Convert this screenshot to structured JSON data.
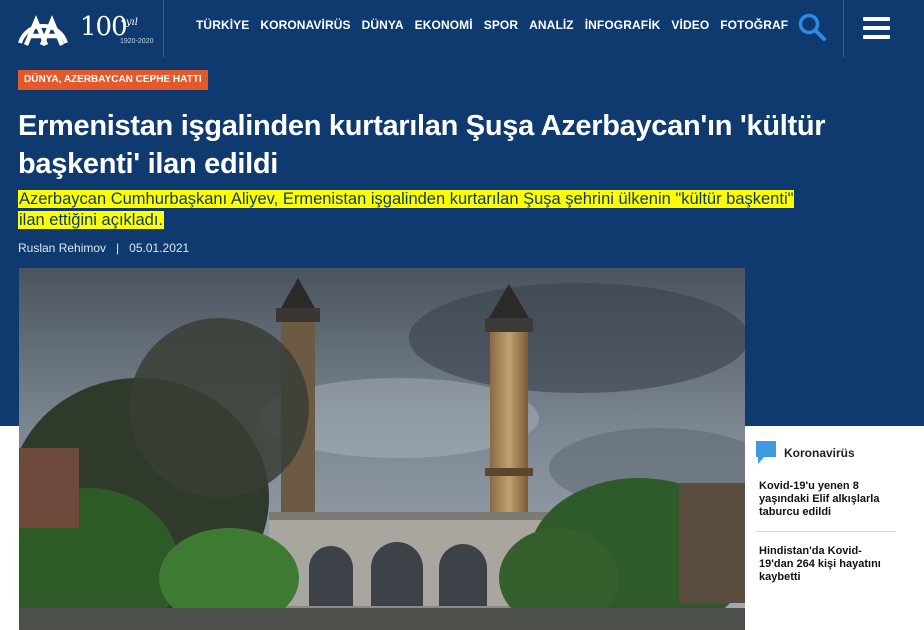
{
  "header": {
    "logo_text": "AA",
    "anniversary_number": "100",
    "anniversary_suffix": "•yıl",
    "anniversary_years": "1920-2020",
    "nav": [
      "TÜRKİYE",
      "KORONAVİRÜS",
      "DÜNYA",
      "EKONOMİ",
      "SPOR",
      "ANALİZ",
      "İNFOGRAFİK",
      "VİDEO",
      "FOTOĞRAF"
    ],
    "search_icon": "search-icon",
    "menu_icon": "hamburger-menu-icon"
  },
  "article": {
    "category": "DÜNYA, AZERBAYCAN CEPHE HATTI",
    "headline": "Ermenistan işgalinden kurtarılan Şuşa Azerbaycan'ın 'kültür başkenti' ilan edildi",
    "summary": "Azerbaycan Cumhurbaşkanı Aliyev, Ermenistan işgalinden kurtarılan Şuşa şehrini ülkenin \"kültür başkenti\" ilan ettiğini açıkladı.",
    "author": "Ruslan Rehimov",
    "separator": "|",
    "date": "05.01.2021"
  },
  "sidebar": {
    "icon": "chat-bubble-icon",
    "title": "Koronavirüs",
    "items": [
      "Kovid-19'u yenen 8 yaşındaki Elif alkışlarla taburcu edildi",
      "Hindistan'da Kovid-19'dan 264 kişi hayatını kaybetti"
    ]
  },
  "colors": {
    "brand_blue": "#0e3a6f",
    "category_orange": "#e25a2c",
    "highlight_yellow": "#ffff00",
    "search_blue": "#2e8be6",
    "sidebar_icon_blue": "#3f9be0"
  }
}
